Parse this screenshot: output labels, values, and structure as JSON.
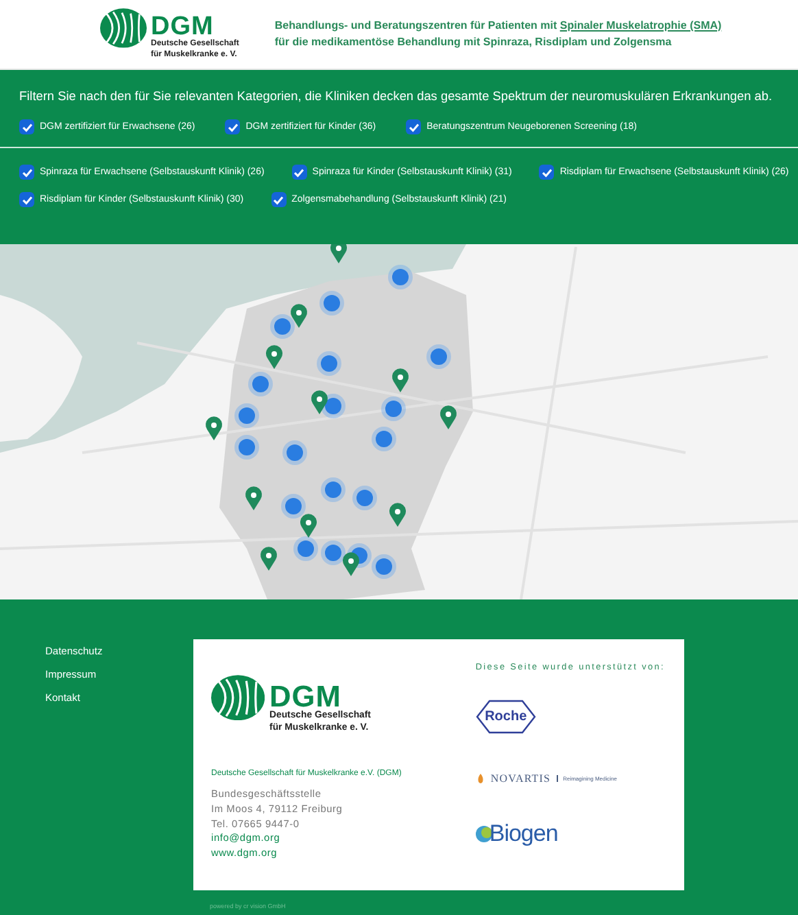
{
  "header": {
    "logo": {
      "wordmark": "DGM",
      "line1": "Deutsche Gesellschaft",
      "line2": "für Muskelkranke e. V."
    },
    "text_before": "Behandlungs- und Beratungszentren für Patienten mit ",
    "link": "Spinaler Muskelatrophie (SMA)",
    "text_after": " für die medikamentöse Behandlung mit Spinraza, Risdiplam und Zolgensma"
  },
  "filters": {
    "intro": "Filtern Sie nach den für Sie relevanten Kategorien, die Kliniken decken das gesamte Spektrum der neuromuskulären Erkrankungen ab.",
    "groups": [
      {
        "items": [
          {
            "label": "DGM zertifiziert für Erwachsene (26)",
            "checked": true
          },
          {
            "label": "DGM zertifiziert für Kinder (36)",
            "checked": true
          },
          {
            "label": "Beratungszentrum Neugeborenen Screening (18)",
            "checked": true
          }
        ]
      },
      {
        "items": [
          {
            "label": "Spinraza für Erwachsene (Selbstauskunft Klinik) (26)",
            "checked": true
          },
          {
            "label": "Spinraza für Kinder (Selbstauskunft Klinik) (31)",
            "checked": true
          },
          {
            "label": "Risdiplam für Erwachsene (Selbstauskunft Klinik) (26)",
            "checked": true
          },
          {
            "label": "Risdiplam für Kinder (Selbstauskunft Klinik) (30)",
            "checked": true
          },
          {
            "label": "Zolgensmabehandlung (Selbstauskunft Klinik) (21)",
            "checked": true
          }
        ]
      }
    ]
  },
  "footer": {
    "links": [
      "Datenschutz",
      "Impressum",
      "Kontakt"
    ],
    "card": {
      "logo": {
        "wordmark": "DGM",
        "line1": "Deutsche Gesellschaft",
        "line2": "für Muskelkranke e. V."
      },
      "org_name": "Deutsche Gesellschaft für Muskelkranke e.V. (DGM)",
      "address": [
        "Bundesgeschäftsstelle",
        "Im Moos 4, 79112 Freiburg",
        "Tel. 07665 9447-0"
      ],
      "email": "info@dgm.org",
      "website": "www.dgm.org",
      "sponsors_title": "Diese Seite wurde unterstützt von:",
      "sponsors": [
        {
          "kind": "roche",
          "name": "Roche"
        },
        {
          "kind": "novartis",
          "name": "NOVARTIS",
          "tagline": "Reimagining Medicine"
        },
        {
          "kind": "biogen",
          "name": "Biogen"
        }
      ]
    },
    "powered_by": "powered by cr vision GmbH"
  }
}
